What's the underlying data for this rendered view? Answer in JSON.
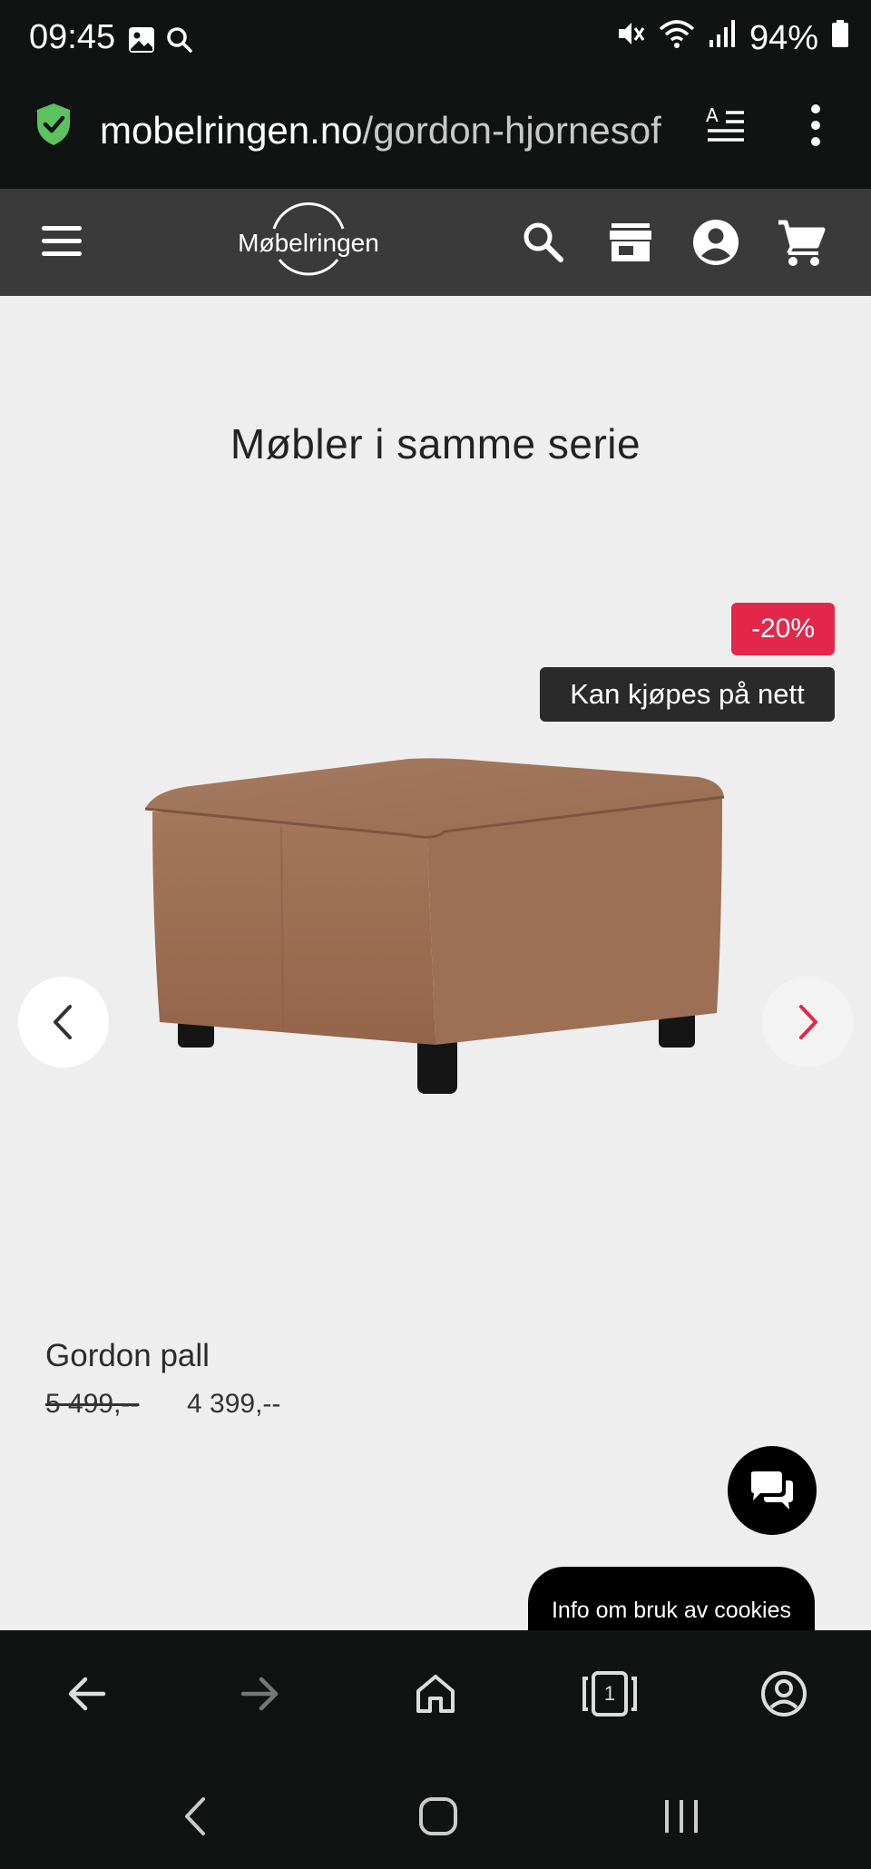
{
  "status_bar": {
    "time": "09:45",
    "battery": "94%",
    "icons": [
      "gallery-icon",
      "search-icon",
      "mute-icon",
      "wifi-icon",
      "signal-icon",
      "battery-icon"
    ]
  },
  "url_bar": {
    "host": "mobelringen.no",
    "path": "/gordon-hjornesof",
    "secure_color": "#5cc25f"
  },
  "site_header": {
    "logo_text": "Møbelringen",
    "icons": [
      "menu-icon",
      "search-icon",
      "store-icon",
      "account-icon",
      "cart-icon"
    ]
  },
  "section": {
    "title": "Møbler i samme serie"
  },
  "product": {
    "discount_badge": "-20%",
    "online_badge": "Kan kjøpes på nett",
    "name": "Gordon pall",
    "old_price": "5 499,--",
    "new_price": "4 399,--",
    "accent_color": "#e3274a"
  },
  "cookie_banner": {
    "label": "Info om bruk av cookies"
  },
  "browser_toolbar": {
    "tab_count": "1",
    "icons": [
      "back-arrow-icon",
      "forward-arrow-icon",
      "home-icon",
      "tabs-icon",
      "profile-icon"
    ]
  },
  "system_nav": {
    "icons": [
      "nav-back-icon",
      "nav-home-icon",
      "nav-recents-icon"
    ]
  }
}
